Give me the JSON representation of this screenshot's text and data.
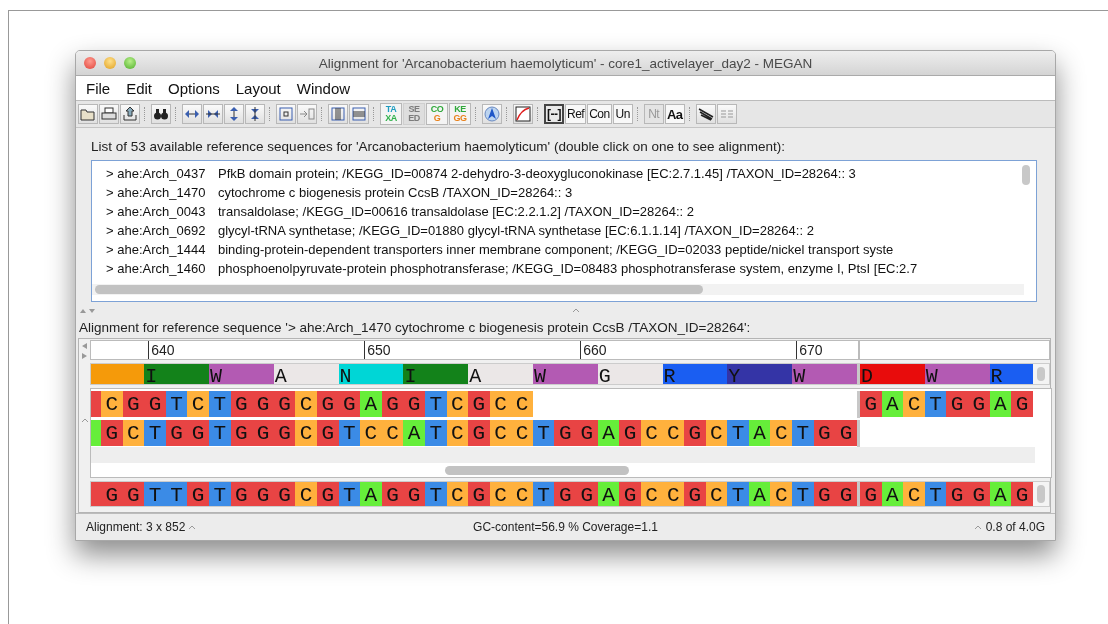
{
  "window": {
    "title": "Alignment for 'Arcanobacterium haemolyticum' - core1_activelayer_day2 - MEGAN"
  },
  "menu": [
    "File",
    "Edit",
    "Options",
    "Layout",
    "Window"
  ],
  "toolbar": {
    "db_buttons": [
      {
        "lines": [
          {
            "text": "TA",
            "color": "#1e9cc0"
          },
          {
            "text": "XA",
            "color": "#2fb24a"
          }
        ],
        "disabled": false
      },
      {
        "lines": [
          {
            "text": "SE",
            "color": "#7c7c7c"
          },
          {
            "text": "ED",
            "color": "#7c7c7c"
          }
        ],
        "disabled": true
      },
      {
        "lines": [
          {
            "text": "CO",
            "color": "#2fa83a"
          },
          {
            "text": "G",
            "color": "#e8801a"
          }
        ],
        "disabled": false
      },
      {
        "lines": [
          {
            "text": "KE",
            "color": "#2fa83a"
          },
          {
            "text": "GG",
            "color": "#e8801a"
          }
        ],
        "disabled": false
      }
    ],
    "view_buttons": [
      {
        "label": "[--]",
        "selected": true,
        "disabled": false
      },
      {
        "label": "Ref",
        "selected": false,
        "disabled": false
      },
      {
        "label": "Con",
        "selected": false,
        "disabled": false
      },
      {
        "label": "Un",
        "selected": false,
        "disabled": false
      }
    ],
    "type_buttons": [
      {
        "label": "Nt",
        "selected": false,
        "disabled": true
      },
      {
        "label": "Aa",
        "selected": false,
        "disabled": false
      }
    ]
  },
  "reference_list": {
    "heading": "List of 53 available reference sequences for 'Arcanobacterium haemolyticum' (double click on one to see alignment):",
    "rows": [
      {
        "id": "> ahe:Arch_0437",
        "description": "PfkB domain protein; /KEGG_ID=00874 2-dehydro-3-deoxygluconokinase [EC:2.7.1.45] /TAXON_ID=28264:: 3"
      },
      {
        "id": "> ahe:Arch_1470",
        "description": "cytochrome c biogenesis protein CcsB /TAXON_ID=28264:: 3"
      },
      {
        "id": "> ahe:Arch_0043",
        "description": "transaldolase; /KEGG_ID=00616 transaldolase [EC:2.2.1.2] /TAXON_ID=28264:: 2"
      },
      {
        "id": "> ahe:Arch_0692",
        "description": "glycyl-tRNA synthetase; /KEGG_ID=01880 glycyl-tRNA synthetase [EC:6.1.1.14] /TAXON_ID=28264:: 2"
      },
      {
        "id": "> ahe:Arch_1444",
        "description": "binding-protein-dependent transporters inner membrane component; /KEGG_ID=02033 peptide/nickel transport syste"
      },
      {
        "id": "> ahe:Arch_1460",
        "description": "phosphoenolpyruvate-protein phosphotransferase; /KEGG_ID=08483 phosphotransferase system, enzyme I, PtsI [EC:2.7"
      }
    ]
  },
  "alignment": {
    "heading": "Alignment for reference sequence '> ahe:Arch_1470  cytochrome c biogenesis protein CcsB /TAXON_ID=28264':",
    "ruler": [
      {
        "label": "640"
      },
      {
        "label": "650"
      },
      {
        "label": "660"
      },
      {
        "label": "670"
      }
    ],
    "amino_acids": [
      [
        {
          "color": "#f59a0a"
        },
        {
          "aa": "I",
          "color": "#13821a"
        },
        {
          "aa": "W",
          "color": "#b35ab3"
        },
        {
          "aa": "A",
          "color": "#ebe7e7"
        },
        {
          "aa": "N",
          "color": "#00d6d6"
        },
        {
          "aa": "I",
          "color": "#13821a"
        },
        {
          "aa": "A",
          "color": "#ebe7e7"
        },
        {
          "aa": "W",
          "color": "#b35ab3"
        },
        {
          "aa": "G",
          "color": "#ebe7e7"
        },
        {
          "aa": "R",
          "color": "#1a5ef2"
        },
        {
          "aa": "Y",
          "color": "#3434a6"
        },
        {
          "aa": "W",
          "color": "#b35ab3"
        }
      ],
      [
        {
          "aa": "D",
          "color": "#e80c0c"
        },
        {
          "aa": "W",
          "color": "#b35ab3"
        },
        {
          "aa": "R",
          "color": "#1a5ef2"
        }
      ]
    ],
    "reads": [
      [
        [
          {
            "color": "#e84444"
          },
          {
            "base": "C",
            "color": "#ffb13d"
          },
          {
            "base": "G",
            "color": "#e84444"
          },
          {
            "base": "G",
            "color": "#e84444"
          },
          {
            "base": "T",
            "color": "#3b8be6"
          },
          {
            "base": "C",
            "color": "#ffb13d"
          },
          {
            "base": "T",
            "color": "#3b8be6"
          },
          {
            "base": "G",
            "color": "#e84444"
          },
          {
            "base": "G",
            "color": "#e84444"
          },
          {
            "base": "G",
            "color": "#e84444"
          },
          {
            "base": "C",
            "color": "#ffb13d"
          },
          {
            "base": "G",
            "color": "#e84444"
          },
          {
            "base": "G",
            "color": "#e84444"
          },
          {
            "base": "A",
            "color": "#66ee3a"
          },
          {
            "base": "G",
            "color": "#e84444"
          },
          {
            "base": "G",
            "color": "#e84444"
          },
          {
            "base": "T",
            "color": "#3b8be6"
          },
          {
            "base": "C",
            "color": "#ffb13d"
          },
          {
            "base": "G",
            "color": "#e84444"
          },
          {
            "base": "C",
            "color": "#ffb13d"
          },
          {
            "base": "C",
            "color": "#ffb13d"
          }
        ],
        [
          {
            "base": "G",
            "color": "#e84444"
          },
          {
            "base": "A",
            "color": "#66ee3a"
          },
          {
            "base": "C",
            "color": "#ffb13d"
          },
          {
            "base": "T",
            "color": "#3b8be6"
          },
          {
            "base": "G",
            "color": "#e84444"
          },
          {
            "base": "G",
            "color": "#e84444"
          },
          {
            "base": "A",
            "color": "#66ee3a"
          },
          {
            "base": "G",
            "color": "#e84444"
          }
        ]
      ],
      [
        [
          {
            "color": "#66ee3a"
          },
          {
            "base": "G",
            "color": "#e84444"
          },
          {
            "base": "C",
            "color": "#ffb13d"
          },
          {
            "base": "T",
            "color": "#3b8be6"
          },
          {
            "base": "G",
            "color": "#e84444"
          },
          {
            "base": "G",
            "color": "#e84444"
          },
          {
            "base": "T",
            "color": "#3b8be6"
          },
          {
            "base": "G",
            "color": "#e84444"
          },
          {
            "base": "G",
            "color": "#e84444"
          },
          {
            "base": "G",
            "color": "#e84444"
          },
          {
            "base": "C",
            "color": "#ffb13d"
          },
          {
            "base": "G",
            "color": "#e84444"
          },
          {
            "base": "T",
            "color": "#3b8be6"
          },
          {
            "base": "C",
            "color": "#ffb13d"
          },
          {
            "base": "C",
            "color": "#ffb13d"
          },
          {
            "base": "A",
            "color": "#66ee3a"
          },
          {
            "base": "T",
            "color": "#3b8be6"
          },
          {
            "base": "C",
            "color": "#ffb13d"
          },
          {
            "base": "G",
            "color": "#e84444"
          },
          {
            "base": "C",
            "color": "#ffb13d"
          },
          {
            "base": "C",
            "color": "#ffb13d"
          },
          {
            "base": "T",
            "color": "#3b8be6"
          },
          {
            "base": "G",
            "color": "#e84444"
          },
          {
            "base": "G",
            "color": "#e84444"
          },
          {
            "base": "A",
            "color": "#66ee3a"
          },
          {
            "base": "G",
            "color": "#e84444"
          },
          {
            "base": "C",
            "color": "#ffb13d"
          },
          {
            "base": "C",
            "color": "#ffb13d"
          },
          {
            "base": "G",
            "color": "#e84444"
          },
          {
            "base": "C",
            "color": "#ffb13d"
          },
          {
            "base": "T",
            "color": "#3b8be6"
          },
          {
            "base": "A",
            "color": "#66ee3a"
          },
          {
            "base": "C",
            "color": "#ffb13d"
          },
          {
            "base": "T",
            "color": "#3b8be6"
          },
          {
            "base": "G",
            "color": "#e84444"
          },
          {
            "base": "G",
            "color": "#e84444"
          }
        ]
      ]
    ],
    "consensus": [
      [
        {
          "color": "#e84444"
        },
        {
          "base": "G",
          "color": "#e84444"
        },
        {
          "base": "G",
          "color": "#e84444"
        },
        {
          "base": "T",
          "color": "#3b8be6"
        },
        {
          "base": "T",
          "color": "#3b8be6"
        },
        {
          "base": "G",
          "color": "#e84444"
        },
        {
          "base": "T",
          "color": "#3b8be6"
        },
        {
          "base": "G",
          "color": "#e84444"
        },
        {
          "base": "G",
          "color": "#e84444"
        },
        {
          "base": "G",
          "color": "#e84444"
        },
        {
          "base": "C",
          "color": "#ffb13d"
        },
        {
          "base": "G",
          "color": "#e84444"
        },
        {
          "base": "T",
          "color": "#3b8be6"
        },
        {
          "base": "A",
          "color": "#66ee3a"
        },
        {
          "base": "G",
          "color": "#e84444"
        },
        {
          "base": "G",
          "color": "#e84444"
        },
        {
          "base": "T",
          "color": "#3b8be6"
        },
        {
          "base": "C",
          "color": "#ffb13d"
        },
        {
          "base": "G",
          "color": "#e84444"
        },
        {
          "base": "C",
          "color": "#ffb13d"
        },
        {
          "base": "C",
          "color": "#ffb13d"
        },
        {
          "base": "T",
          "color": "#3b8be6"
        },
        {
          "base": "G",
          "color": "#e84444"
        },
        {
          "base": "G",
          "color": "#e84444"
        },
        {
          "base": "A",
          "color": "#66ee3a"
        },
        {
          "base": "G",
          "color": "#e84444"
        },
        {
          "base": "C",
          "color": "#ffb13d"
        },
        {
          "base": "C",
          "color": "#ffb13d"
        },
        {
          "base": "G",
          "color": "#e84444"
        },
        {
          "base": "C",
          "color": "#ffb13d"
        },
        {
          "base": "T",
          "color": "#3b8be6"
        },
        {
          "base": "A",
          "color": "#66ee3a"
        },
        {
          "base": "C",
          "color": "#ffb13d"
        },
        {
          "base": "T",
          "color": "#3b8be6"
        },
        {
          "base": "G",
          "color": "#e84444"
        },
        {
          "base": "G",
          "color": "#e84444"
        }
      ],
      [
        {
          "base": "G",
          "color": "#e84444"
        },
        {
          "base": "A",
          "color": "#66ee3a"
        },
        {
          "base": "C",
          "color": "#ffb13d"
        },
        {
          "base": "T",
          "color": "#3b8be6"
        },
        {
          "base": "G",
          "color": "#e84444"
        },
        {
          "base": "G",
          "color": "#e84444"
        },
        {
          "base": "A",
          "color": "#66ee3a"
        },
        {
          "base": "G",
          "color": "#e84444"
        }
      ]
    ]
  },
  "status_bar": {
    "left": "Alignment: 3 x 852",
    "center": "GC-content=56.9 % Coverage=1.1",
    "right": "0.8 of 4.0G"
  }
}
